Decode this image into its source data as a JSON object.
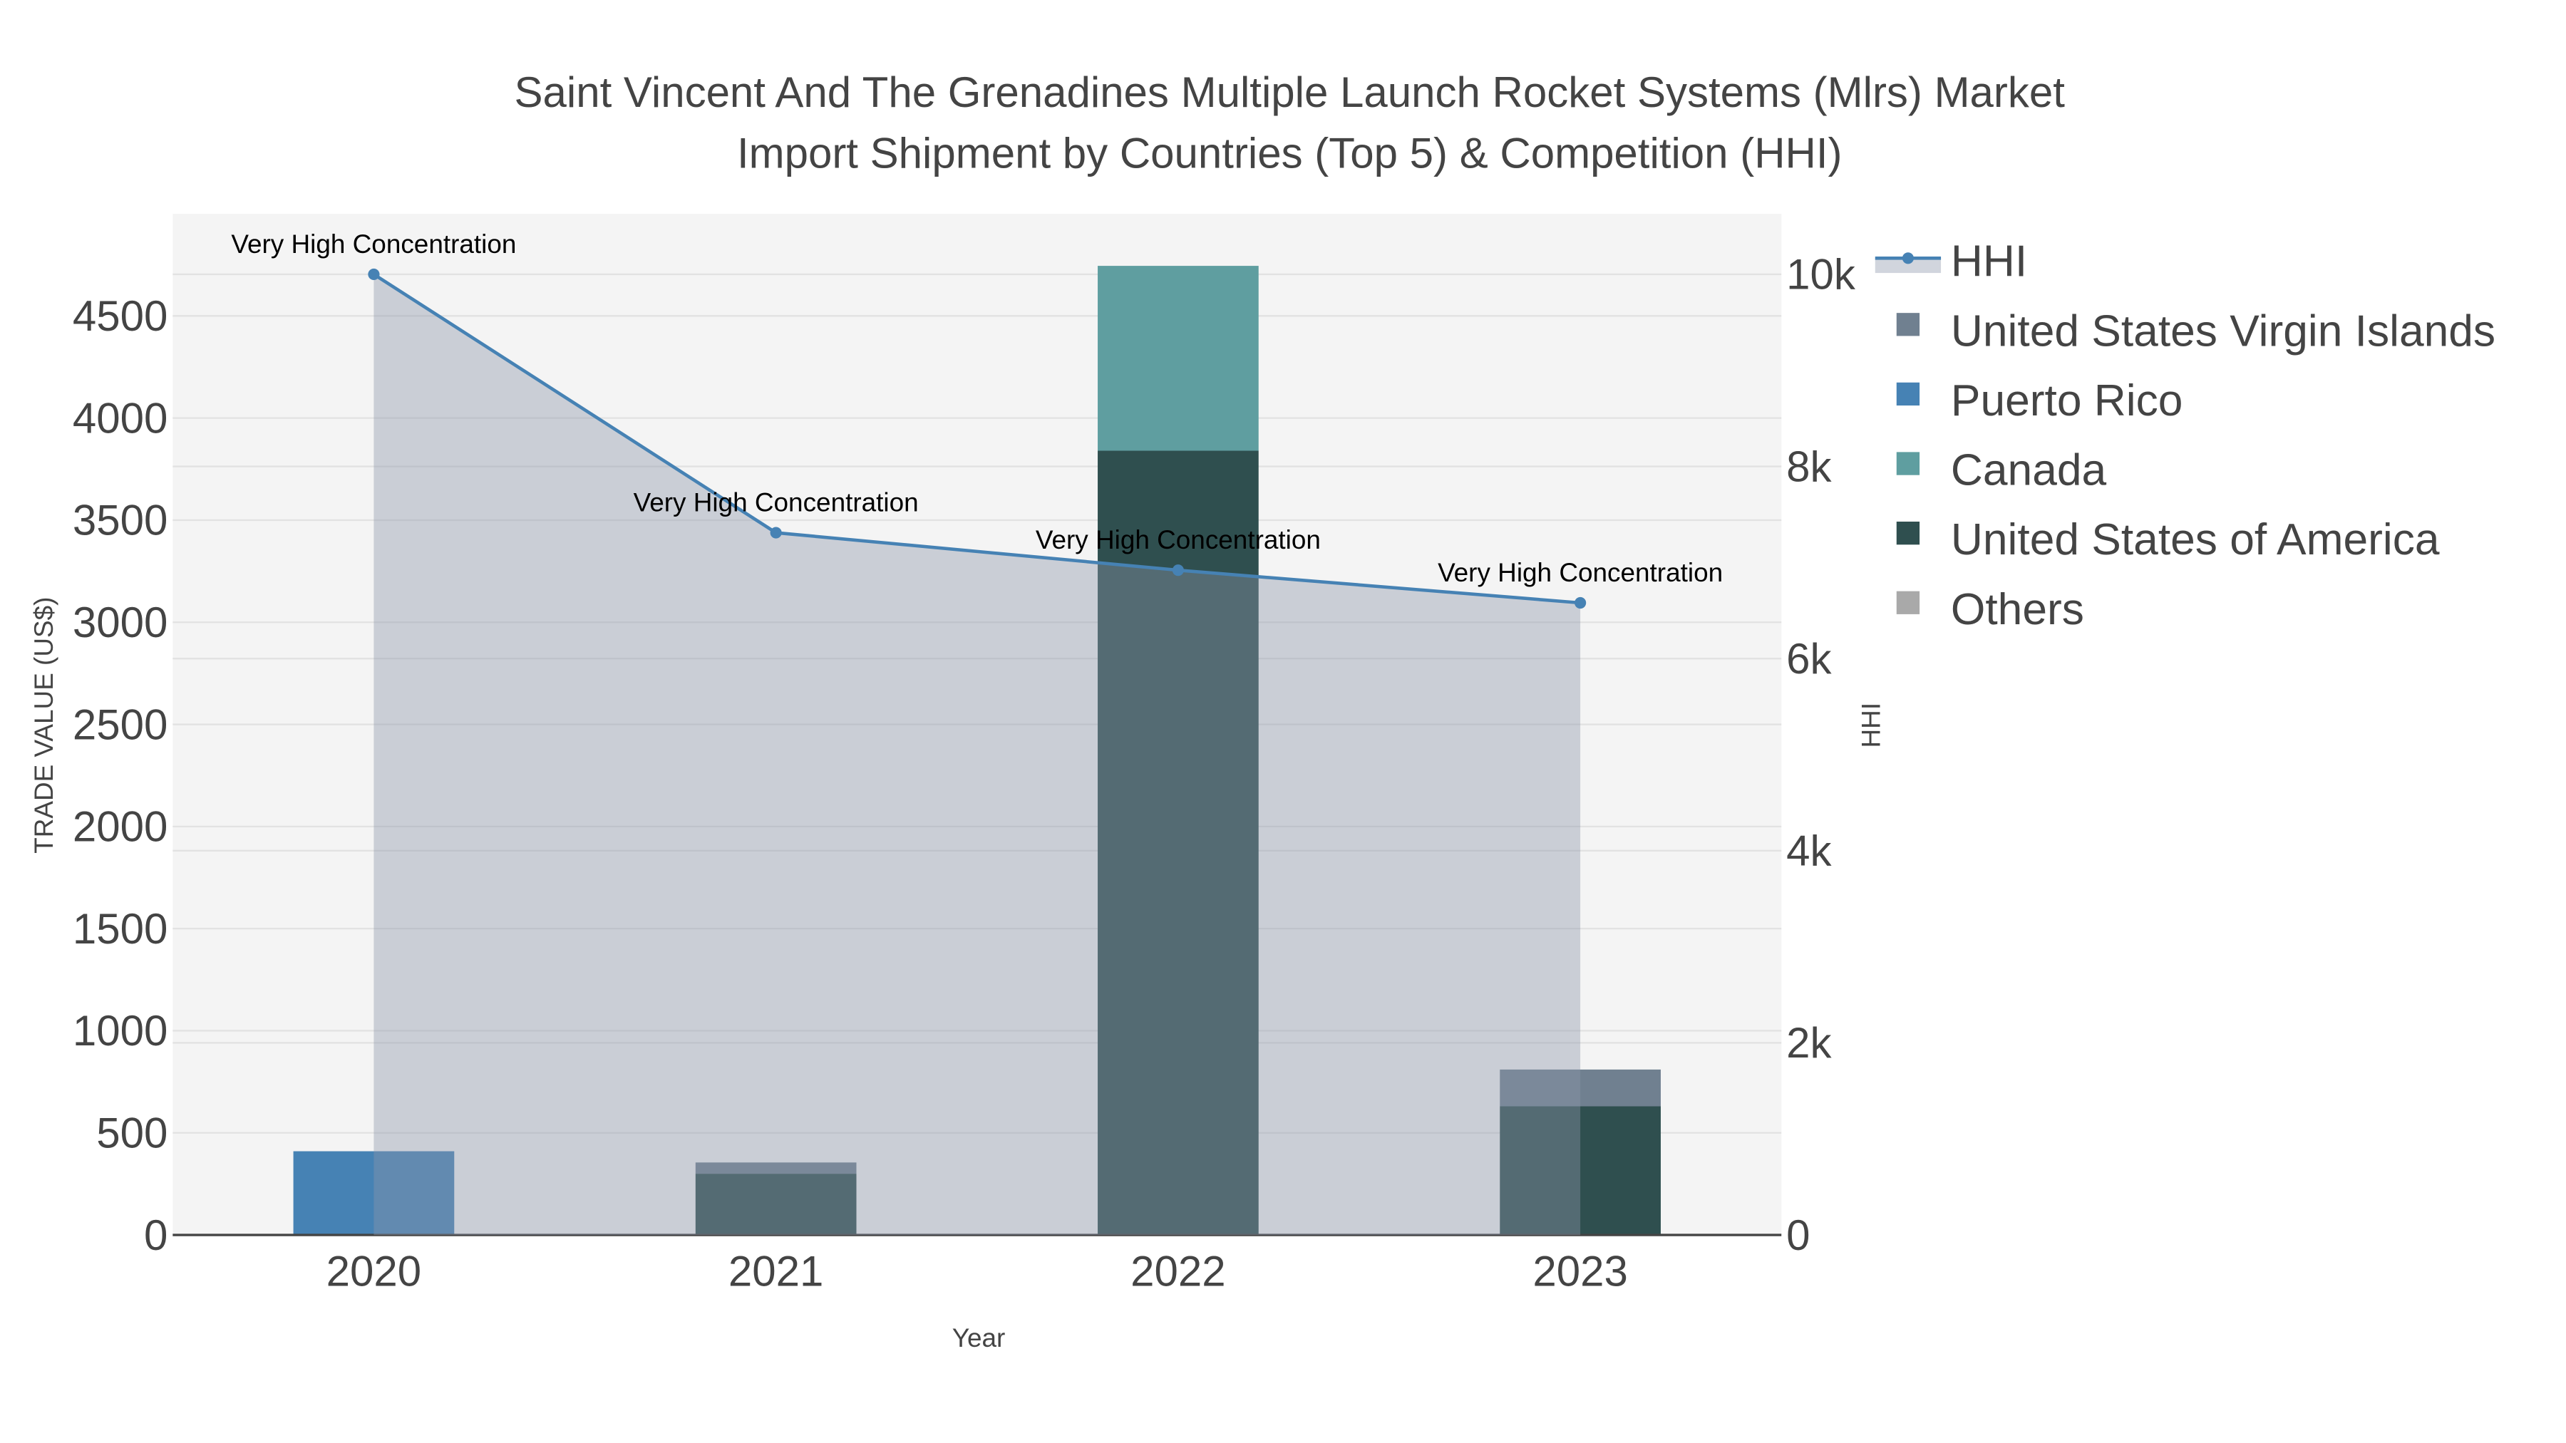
{
  "chart_data": {
    "type": "bar",
    "barmode": "stack",
    "title_lines": [
      "Saint Vincent And The Grenadines Multiple Launch Rocket Systems (Mlrs) Market",
      "Import Shipment by Countries (Top 5) & Competition (HHI)"
    ],
    "xlabel": "Year",
    "ylabel": "TRADE VALUE (US$)",
    "y2label": "HHI",
    "categories": [
      "2020",
      "2021",
      "2022",
      "2023"
    ],
    "ylim": [
      0,
      5000
    ],
    "yticks": [
      0,
      500,
      1000,
      1500,
      2000,
      2500,
      3000,
      3500,
      4000,
      4500
    ],
    "y2lim": [
      0,
      10630
    ],
    "y2ticks": [
      0,
      2000,
      4000,
      6000,
      8000,
      10000
    ],
    "y2ticklabels": [
      "0",
      "2k",
      "4k",
      "6k",
      "8k",
      "10k"
    ],
    "grid": true,
    "legend_position": "right",
    "series": [
      {
        "name": "United States of America",
        "color": "#2f4f4f",
        "values": [
          0,
          300,
          3840,
          630
        ]
      },
      {
        "name": "Canada",
        "color": "#5f9ea0",
        "values": [
          0,
          0,
          905,
          0
        ]
      },
      {
        "name": "Puerto Rico",
        "color": "#4682b4",
        "values": [
          410,
          0,
          0,
          0
        ]
      },
      {
        "name": "United States Virgin Islands",
        "color": "#708090",
        "values": [
          0,
          55,
          0,
          180
        ]
      },
      {
        "name": "Others",
        "color": "#a9a9a9",
        "values": [
          0,
          0,
          0,
          0
        ]
      }
    ],
    "hhi": {
      "name": "HHI",
      "color": "#4682b4",
      "fill": "rgba(140,150,170,0.4)",
      "values": [
        10000,
        7310,
        6920,
        6580
      ],
      "annotations": [
        "Very High Concentration",
        "Very High Concentration",
        "Very High Concentration",
        "Very High Concentration"
      ]
    },
    "legend_order": [
      "HHI",
      "United States Virgin Islands",
      "Puerto Rico",
      "Canada",
      "United States of America",
      "Others"
    ]
  }
}
